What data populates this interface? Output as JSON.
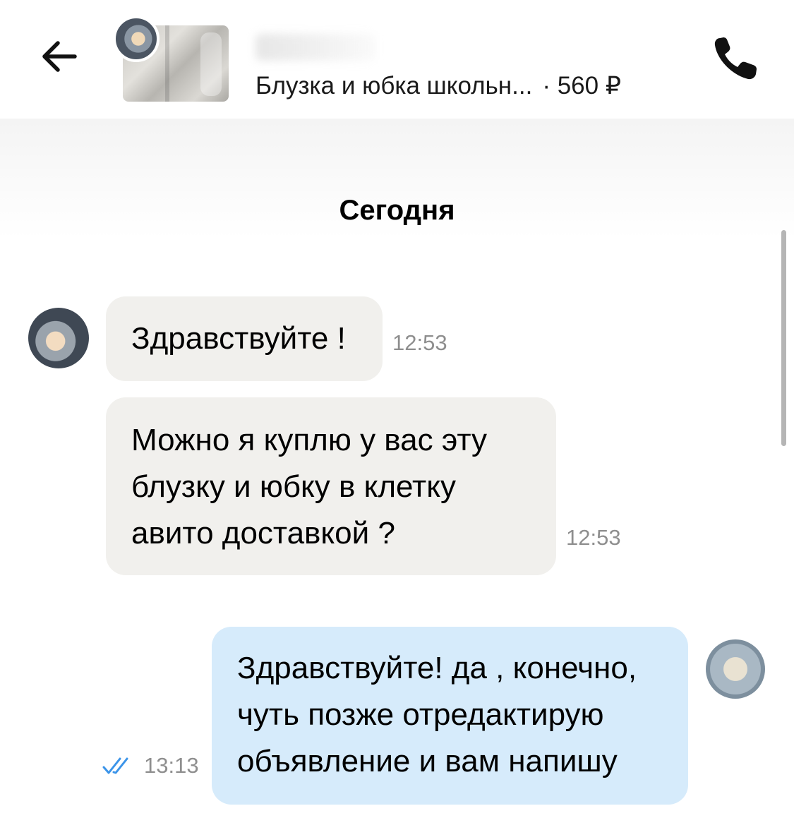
{
  "header": {
    "listing_title": "Блузка и юбка школьн...",
    "price": "· 560 ₽"
  },
  "chat": {
    "date_label": "Сегодня",
    "messages": [
      {
        "direction": "incoming",
        "lines": [
          "Здравствуйте !"
        ],
        "time": "12:53"
      },
      {
        "direction": "incoming",
        "lines": [
          "Можно я куплю у вас эту",
          "блузку и юбку в клетку",
          "авито доставкой ?"
        ],
        "time": "12:53"
      },
      {
        "direction": "outgoing",
        "lines": [
          "Здравствуйте! да , конечно,",
          "чуть позже отредактирую",
          "объявление и вам напишу"
        ],
        "time": "13:13",
        "status_icon": "double-check-icon"
      }
    ]
  },
  "icons": {
    "back": "arrow-left-icon",
    "call": "phone-icon",
    "read": "double-check-icon"
  },
  "colors": {
    "incoming_bubble": "#f1f0ed",
    "outgoing_bubble": "#d6ebfb",
    "timestamp": "#8e8e8e",
    "read_check": "#3b94e9"
  }
}
